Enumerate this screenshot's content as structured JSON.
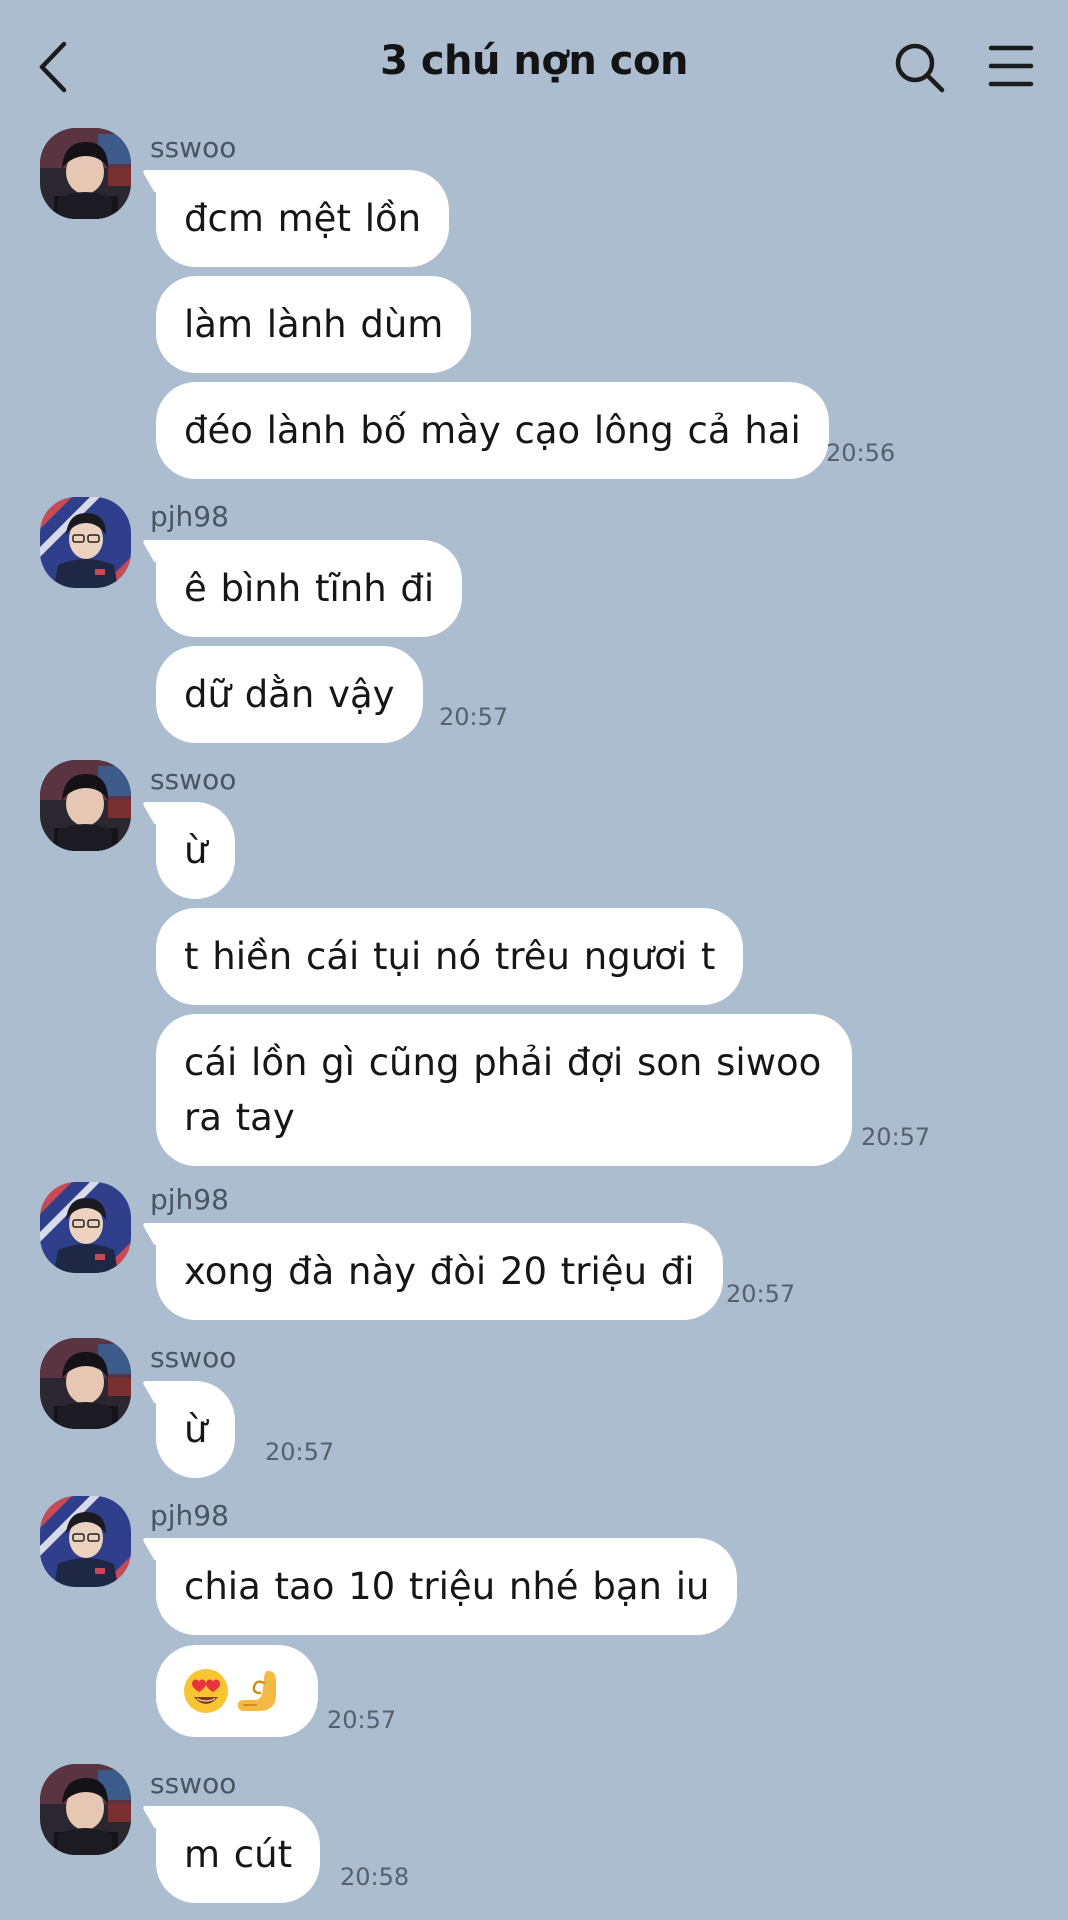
{
  "header": {
    "title": "3 chú nợn con",
    "back_icon": "chevron-left-icon",
    "search_icon": "search-icon",
    "menu_icon": "menu-icon"
  },
  "colors": {
    "background": "#abbdcf",
    "bubble": "#ffffff",
    "text": "#161616",
    "meta_text": "#56616c"
  },
  "messages": [
    {
      "sender": "sswoo",
      "bubbles": [
        "đcm mệt lồn",
        "làm lành dùm",
        "đéo lành bố mày cạo lông cả hai"
      ],
      "time": "20:56"
    },
    {
      "sender": "pjh98",
      "bubbles": [
        "ê bình tĩnh đi",
        "dữ dằn vậy"
      ],
      "time": "20:57"
    },
    {
      "sender": "sswoo",
      "bubbles": [
        "ừ",
        "t hiền cái tụi nó trêu ngươi t",
        "cái lồn gì cũng phải đợi son siwoo ra tay"
      ],
      "time": "20:57"
    },
    {
      "sender": "pjh98",
      "bubbles": [
        "xong đà này đòi 20 triệu đi"
      ],
      "time": "20:57"
    },
    {
      "sender": "sswoo",
      "bubbles": [
        "ừ"
      ],
      "time": "20:57"
    },
    {
      "sender": "pjh98",
      "bubbles": [
        "chia tao 10 triệu nhé bạn iu",
        "heart-eyes-emoji pinching-hand-emoji"
      ],
      "time": "20:57"
    },
    {
      "sender": "sswoo",
      "bubbles": [
        "m cút"
      ],
      "time": "20:58"
    }
  ]
}
